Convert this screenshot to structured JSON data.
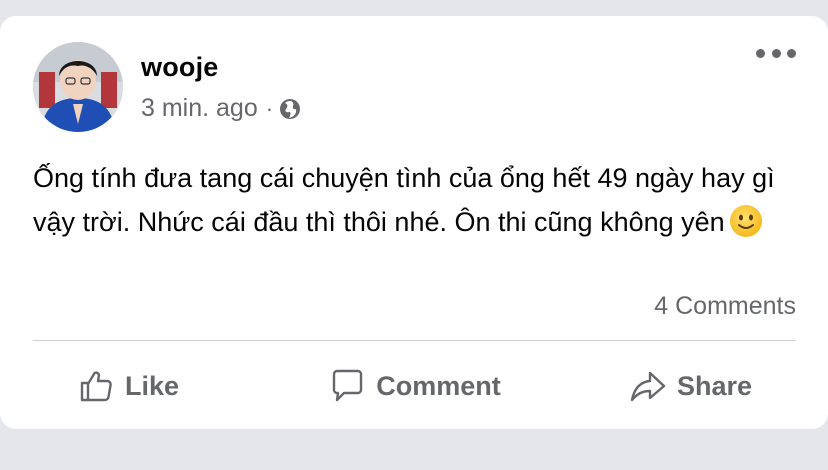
{
  "post": {
    "author": "wooje",
    "timestamp": "3 min. ago",
    "separator": "·",
    "privacy_icon": "globe-icon",
    "text": "Ống tính đưa tang cái chuyện tình của ổng hết 49 ngày hay gì vậy trời. Nhức cái đầu thì thôi nhé. Ôn thi cũng không yên",
    "emoji": "slightly-smiling-face-icon",
    "comments_count": "4 Comments"
  },
  "actions": {
    "like_label": "Like",
    "comment_label": "Comment",
    "share_label": "Share"
  },
  "colors": {
    "background": "#e4e6eb",
    "card": "#ffffff",
    "text": "#050505",
    "secondary_text": "#65676b",
    "divider": "#ced0d4"
  }
}
